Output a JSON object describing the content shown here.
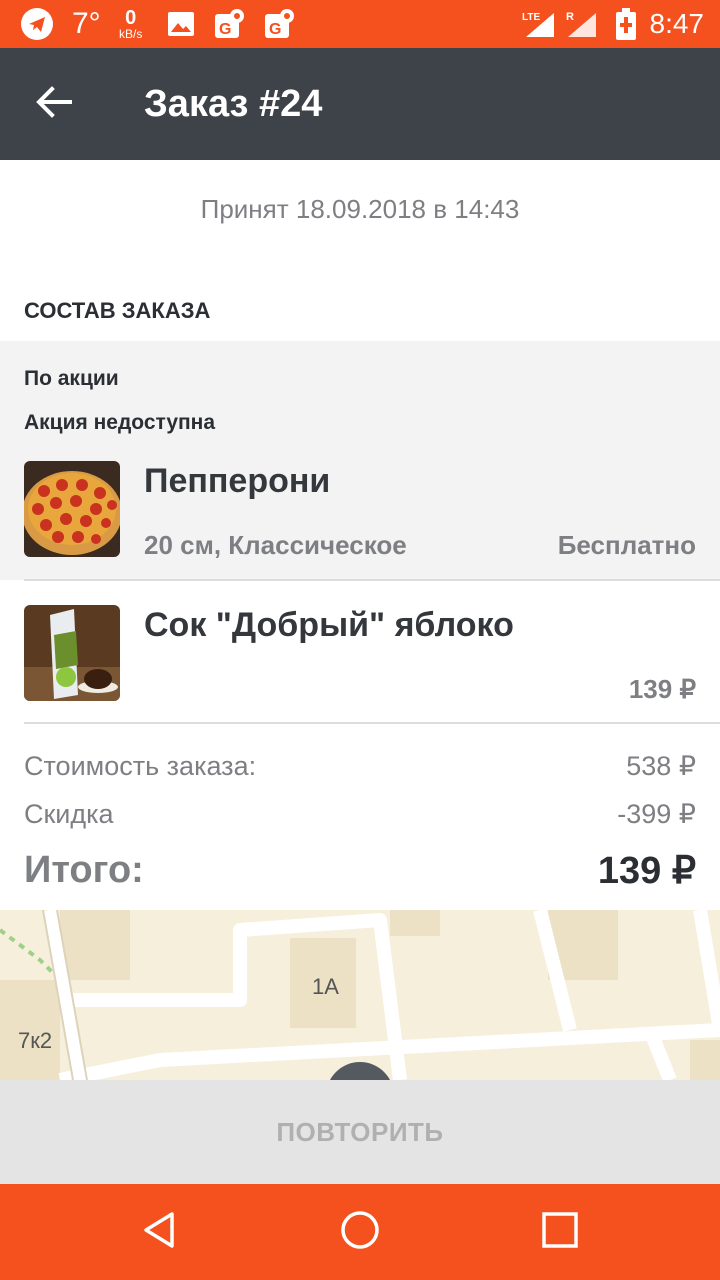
{
  "status_bar": {
    "temperature": "7°",
    "net_speed_value": "0",
    "net_speed_unit": "kB/s",
    "network_type": "LTE",
    "roaming": "R",
    "time": "8:47"
  },
  "app_bar": {
    "title": "Заказ #24"
  },
  "order": {
    "accepted_text": "Принят 18.09.2018 в 14:43",
    "section_title": "СОСТАВ ЗАКАЗА",
    "promo_title": "По акции",
    "promo_status": "Акция недоступна",
    "items": [
      {
        "name": "Пепперони",
        "description": "20 см, Классическое",
        "price": "Бесплатно",
        "image": "pizza-image"
      },
      {
        "name": "Сок \"Добрый\" яблоко",
        "description": "",
        "price": "139 ₽",
        "image": "juice-image"
      }
    ],
    "summary": {
      "cost_label": "Стоимость заказа:",
      "cost_value": "538 ₽",
      "discount_label": "Скидка",
      "discount_value": "-399 ₽",
      "total_label": "Итого:",
      "total_value": "139 ₽"
    }
  },
  "map": {
    "labels": [
      "1А",
      "7к2"
    ]
  },
  "actions": {
    "repeat_label": "ПОВТОРИТЬ"
  },
  "colors": {
    "accent": "#f4511e",
    "app_bar": "#3e4249",
    "text_dark": "#2b2e33",
    "text_muted": "#7d7f83"
  }
}
